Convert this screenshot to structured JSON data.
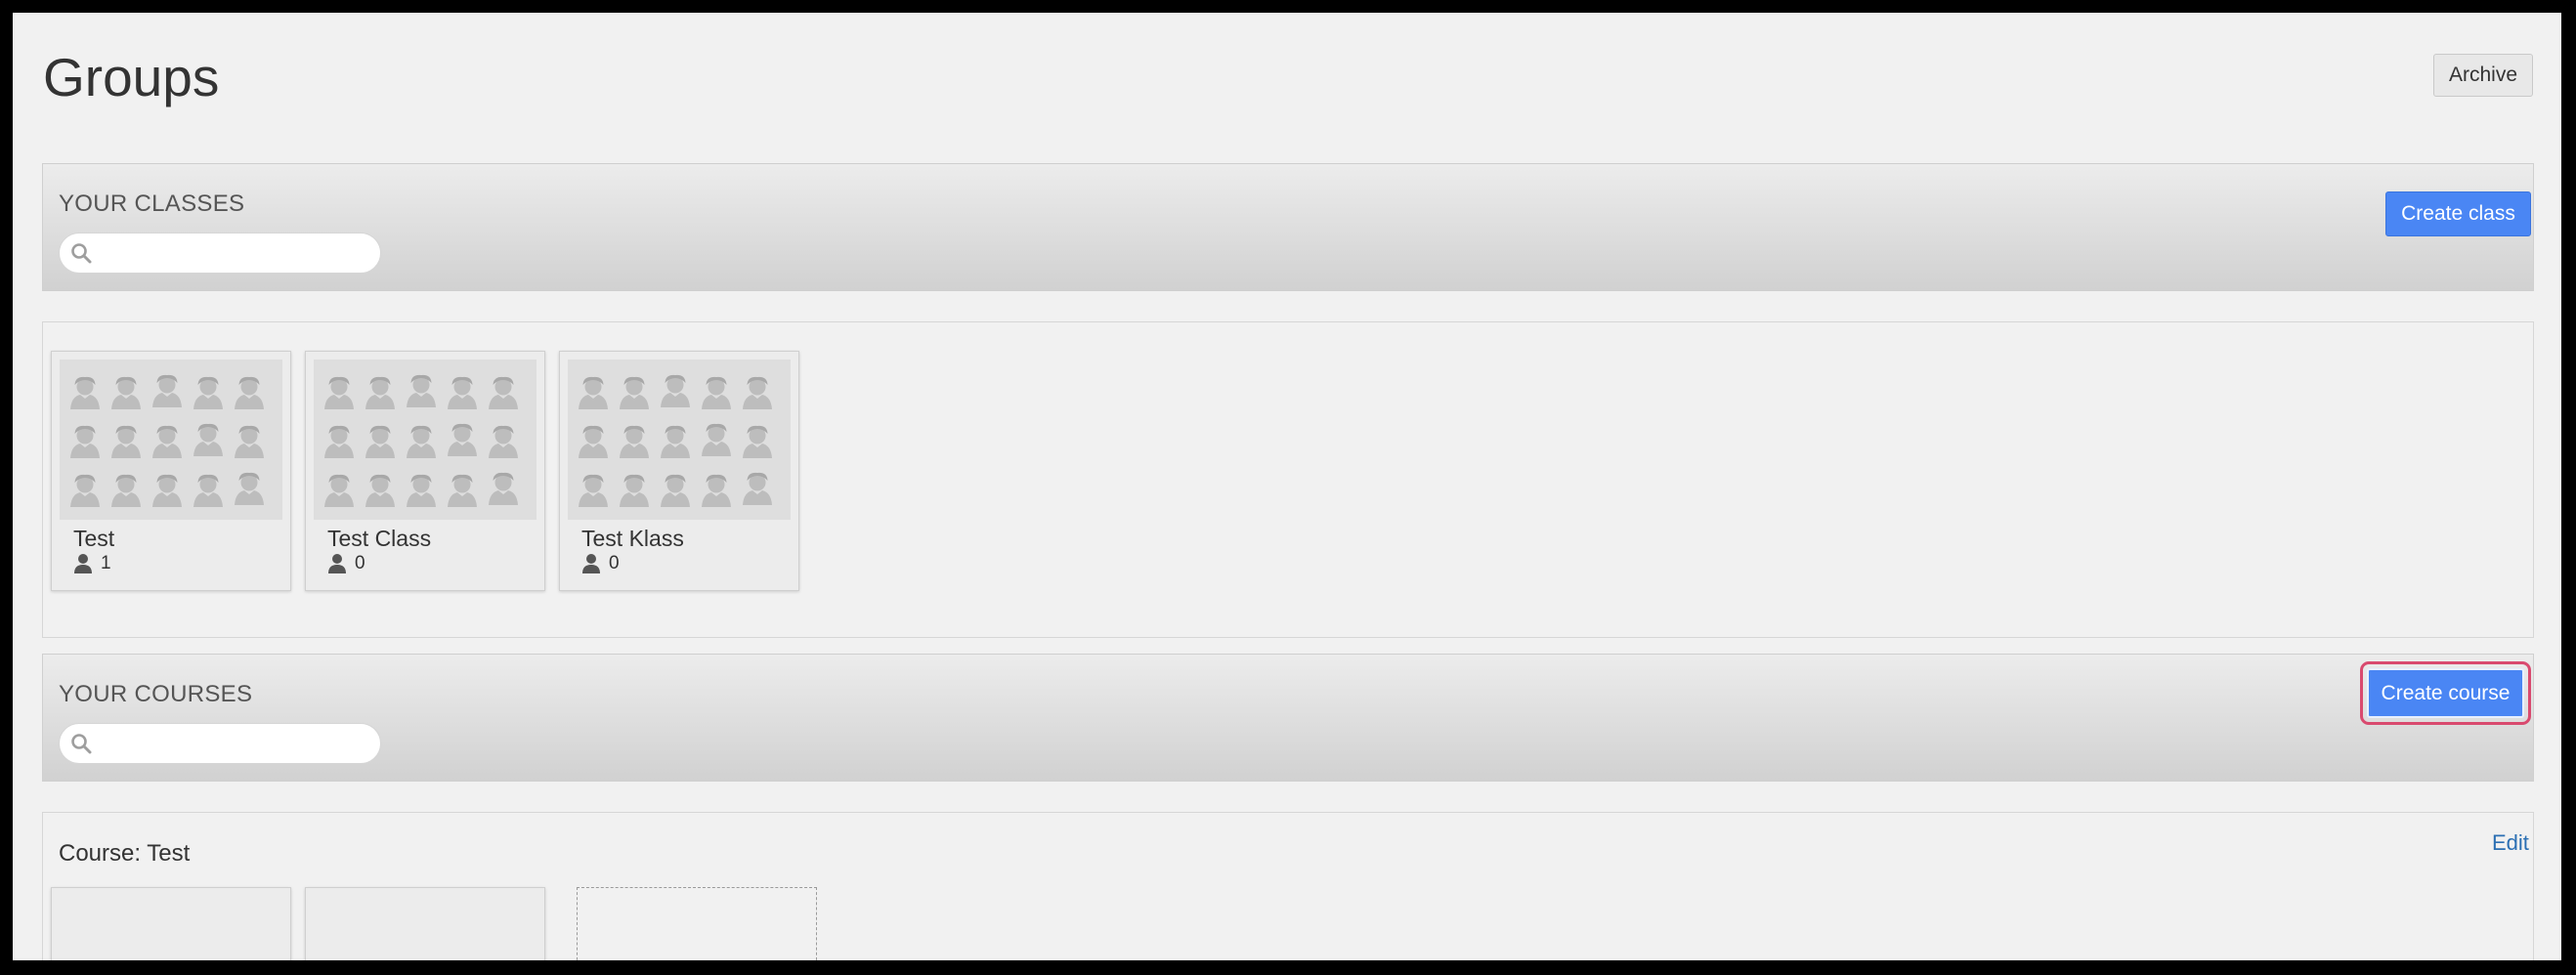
{
  "page": {
    "title": "Groups",
    "archive_label": "Archive"
  },
  "classes_section": {
    "title": "YOUR CLASSES",
    "create_label": "Create class",
    "search_placeholder": ""
  },
  "classes": [
    {
      "name": "Test",
      "member_count": "1"
    },
    {
      "name": "Test Class",
      "member_count": "0"
    },
    {
      "name": "Test Klass",
      "member_count": "0"
    }
  ],
  "courses_section": {
    "title": "YOUR COURSES",
    "create_label": "Create course",
    "search_placeholder": ""
  },
  "courses": [
    {
      "title": "Course: Test",
      "edit_label": "Edit"
    }
  ],
  "icons": {
    "search": "search-icon",
    "person": "person-icon",
    "class_placeholder": "people-group-icon"
  },
  "colors": {
    "primary": "#4a86f4",
    "focus_ring": "#d94a6f",
    "link": "#2b6fb3",
    "background": "#f1f1f1"
  }
}
